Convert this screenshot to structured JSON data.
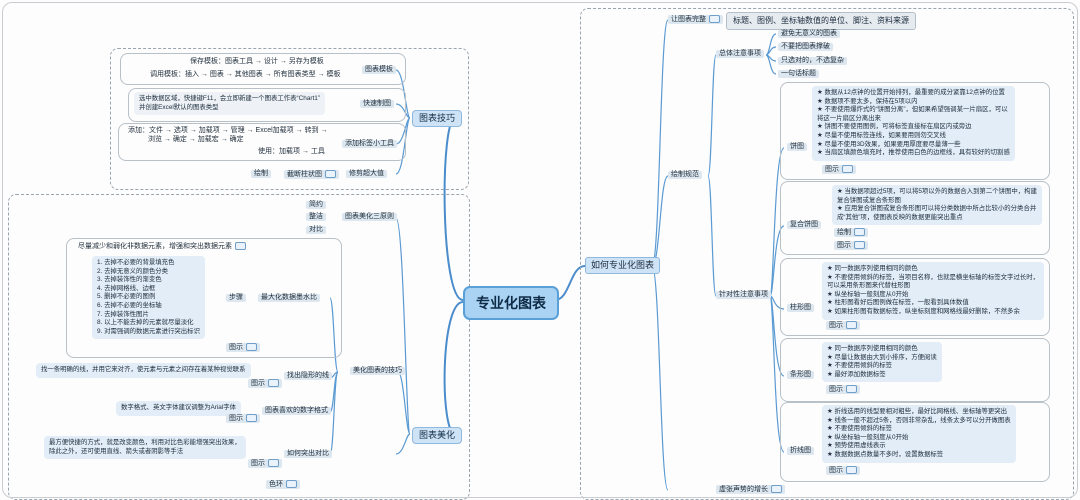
{
  "root": "专业化图表",
  "right": {
    "branch": "如何专业化图表",
    "groups": {
      "complete": "让图表完整",
      "complete_note": "标题、图例、坐标轴数值的单位、脚注、资料来源",
      "norms": "绘制规范",
      "general": "总体注意事项",
      "general_items": [
        "避免无意义的图表",
        "不要把图表撑破",
        "只选对的，不选复杂",
        "一句话标题"
      ],
      "chart_points": "针对性注意事项",
      "pie": "饼图",
      "pie_notes": [
        "★ 数据从12点钟的位置开始排列，最重要的成分紧靠12点钟的位置",
        "★ 数据项不要太多，保持在5项以内",
        "★ 不要使用爆炸式的“饼图分离”，但如果希望强调某一片扇区，可以",
        "   将这一片扇区分离出来",
        "★ 饼图不要使用图例，可将标签直接标在扇区内或旁边",
        "★ 尽量不使用标签连线，如果要用则勿交叉线",
        "★ 尽量不使用3D效果，如果要用厚度要尽量薄一些",
        "★ 当扇区填颜色填充时，推荐使用白色的边框线，具有较好的切割感"
      ],
      "pie_ref": "图示",
      "compound_pie": "复合饼图",
      "compound_notes": [
        "★ 当数据项超过5项，可以将5项以外的数据合入到第二个饼图中，构建",
        "   复合饼图或复合条形图",
        "★ 应用复合饼图或复合条形图可以将分类数据中所占比较小的分类合并",
        "   成“其他”项，使图表反映的数据更能突出重点"
      ],
      "compound_draw": "绘制",
      "compound_ref": "图示",
      "column": "柱形图",
      "column_notes": [
        "★ 同一数据序列使用相同的颜色",
        "★ 不要使用倾斜的标签，当项目名称，也就是横坐标轴的标签文字过长时，",
        "   可以采用条形图来代替柱形图",
        "★ 纵坐标轴一般刻度从0开始",
        "★ 柱形图看好后图例做在标签，一般看到具体数值",
        "★ 如果柱形图有数据标签，纵坐标刻度和网格线最好删除，不然多余"
      ],
      "column_ref": "图示",
      "bar": "条形图",
      "bar_notes": [
        "★ 同一数据序列使用相同的颜色",
        "★ 尽量让数据由大到小排序，方便阅读",
        "★ 不要使用倾斜的标签",
        "★ 最好添加数据标签"
      ],
      "bar_ref": "图示",
      "line": "折线图",
      "line_notes": [
        "★ 折线选用的线型要相对粗些，最好比网格线、坐标轴等更突出",
        "★ 线条一般不超过5条，否则非常杂乱，线条太多可以分开做图表",
        "★ 不要使用倾斜的标签",
        "★ 纵坐标轴一般刻度从0开始",
        "★ 预势使用虚线表示",
        "★ 数据数据点数量不多时，设置数据标签"
      ],
      "line_ref": "图示",
      "bottom_cut": "虚张声势的增长"
    }
  },
  "left": {
    "skills": {
      "branch": "图表技巧",
      "template": "图表模板",
      "template_items": [
        "保存模板：图表工具 → 设计 → 另存为模板",
        "调用模板：插入 → 图表 → 其他图表 → 所有图表类型 → 模板"
      ],
      "quick": "快速制图",
      "quick_note": [
        "选中数据区域，快捷键F11，会立即新建一个图表工作表“Chart1”",
        "并创建Excel默认的图表类型"
      ],
      "addin": "添加标签小工具",
      "addin_items": [
        "添加：文件 → 选项 → 加载项 → 管理 → Excel加载项 → 转到 →",
        "浏览 → 确定 → 加载宏 → 确定",
        "使用：加载项 → 工具"
      ],
      "draw": "绘制",
      "truncate": "截断柱状图",
      "bigvalue": "修剪超大值"
    },
    "beauty": {
      "branch": "图表美化",
      "three": "图表美化三原则",
      "three_items": [
        "简约",
        "整洁",
        "对比"
      ],
      "tips": "美化图表的技巧",
      "ratio": "最大化数据墨水比",
      "ratio_top": "尽量减少和弱化非数据元素，增强和突出数据元素",
      "steps_label": "步骤",
      "steps": [
        "1. 去掉不必要的背景填充色",
        "2. 去掉无意义的颜色分类",
        "3. 去掉装饰性的渐变色",
        "4. 去掉网格线、边框",
        "5. 删掉不必要的图例",
        "6. 去掉不必要的坐标轴",
        "7. 去掉装饰性图片",
        "8. 以上不能去掉的元素就尽量淡化",
        "9. 对需强调的数据元素进行突出标识"
      ],
      "ratio_ref": "图示",
      "hidden": "找出隐形的线",
      "hidden_note": "找一条明确的线，并用它来对齐，使元素与元素之间存在着某种视觉联系",
      "hidden_ref": "图示",
      "number": "图表喜欢的数字格式",
      "number_note": "数字格式、英文字体建议调整为Arial字体",
      "number_ref": "图示",
      "contrast": "如何突出对比",
      "contrast_note": [
        "最方便快捷的方式，就是改变颜色，利用对比色彩能增强突出效果，",
        "除此之外，还可使用直线、箭头或者阴影等手法"
      ],
      "contrast_ref": "图示",
      "color": "色环"
    }
  }
}
